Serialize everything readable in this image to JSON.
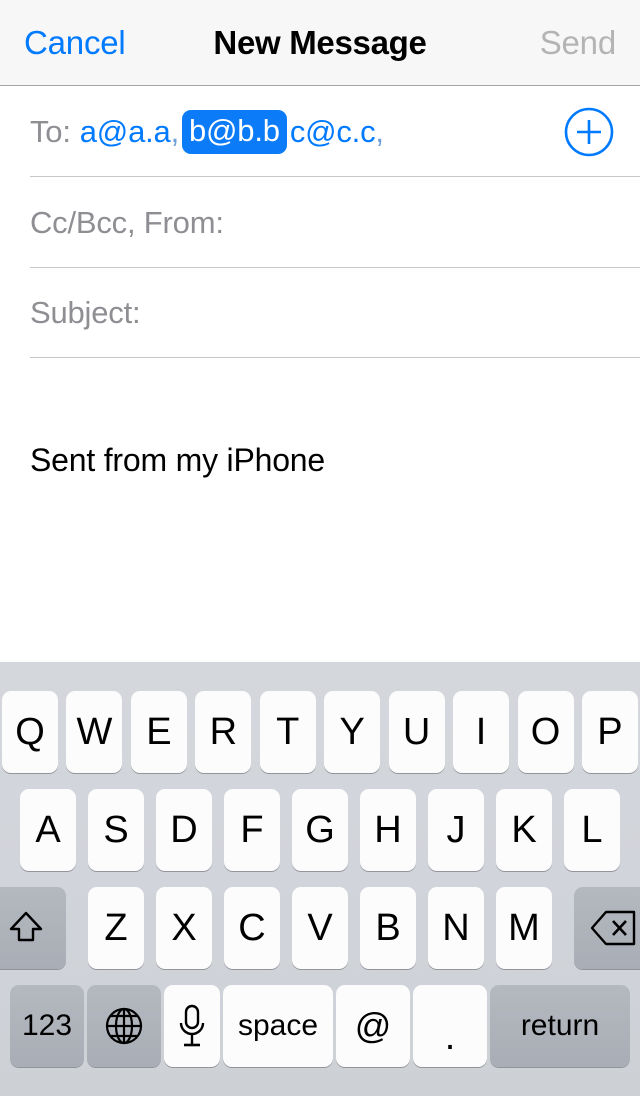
{
  "navbar": {
    "cancel_label": "Cancel",
    "title": "New Message",
    "send_label": "Send",
    "cancel_color": "#007aff",
    "send_color": "#b4b4b4"
  },
  "compose": {
    "to": {
      "label": "To:",
      "recipients": [
        {
          "address": "a@a.a",
          "selected": false,
          "trailing": ","
        },
        {
          "address": "b@b.b",
          "selected": true,
          "trailing": ""
        },
        {
          "address": "c@c.c",
          "selected": false,
          "trailing": ","
        }
      ],
      "add_contact_icon": "plus-circle-icon"
    },
    "ccbcc": {
      "placeholder": "Cc/Bcc, From:"
    },
    "subject": {
      "placeholder": "Subject:"
    },
    "body": {
      "text": "Sent from my iPhone"
    },
    "selection_color": "#0b7bf7",
    "link_color": "#007aff",
    "placeholder_color": "#8e8e93"
  },
  "keyboard": {
    "row1": [
      "Q",
      "W",
      "E",
      "R",
      "T",
      "Y",
      "U",
      "I",
      "O",
      "P"
    ],
    "row2": [
      "A",
      "S",
      "D",
      "F",
      "G",
      "H",
      "J",
      "K",
      "L"
    ],
    "row3": {
      "shift_icon": "shift-arrow-icon",
      "letters": [
        "Z",
        "X",
        "C",
        "V",
        "B",
        "N",
        "M"
      ],
      "backspace_icon": "backspace-delete-icon"
    },
    "row4": {
      "numeric_label": "123",
      "globe_icon": "globe-icon",
      "mic_icon": "microphone-icon",
      "space_label": "space",
      "at_label": "@",
      "dot_label": ".",
      "return_label": "return"
    },
    "background_color": "#d1d4da",
    "key_color": "#fcfcfc",
    "special_key_color": "#aeb3bb"
  }
}
